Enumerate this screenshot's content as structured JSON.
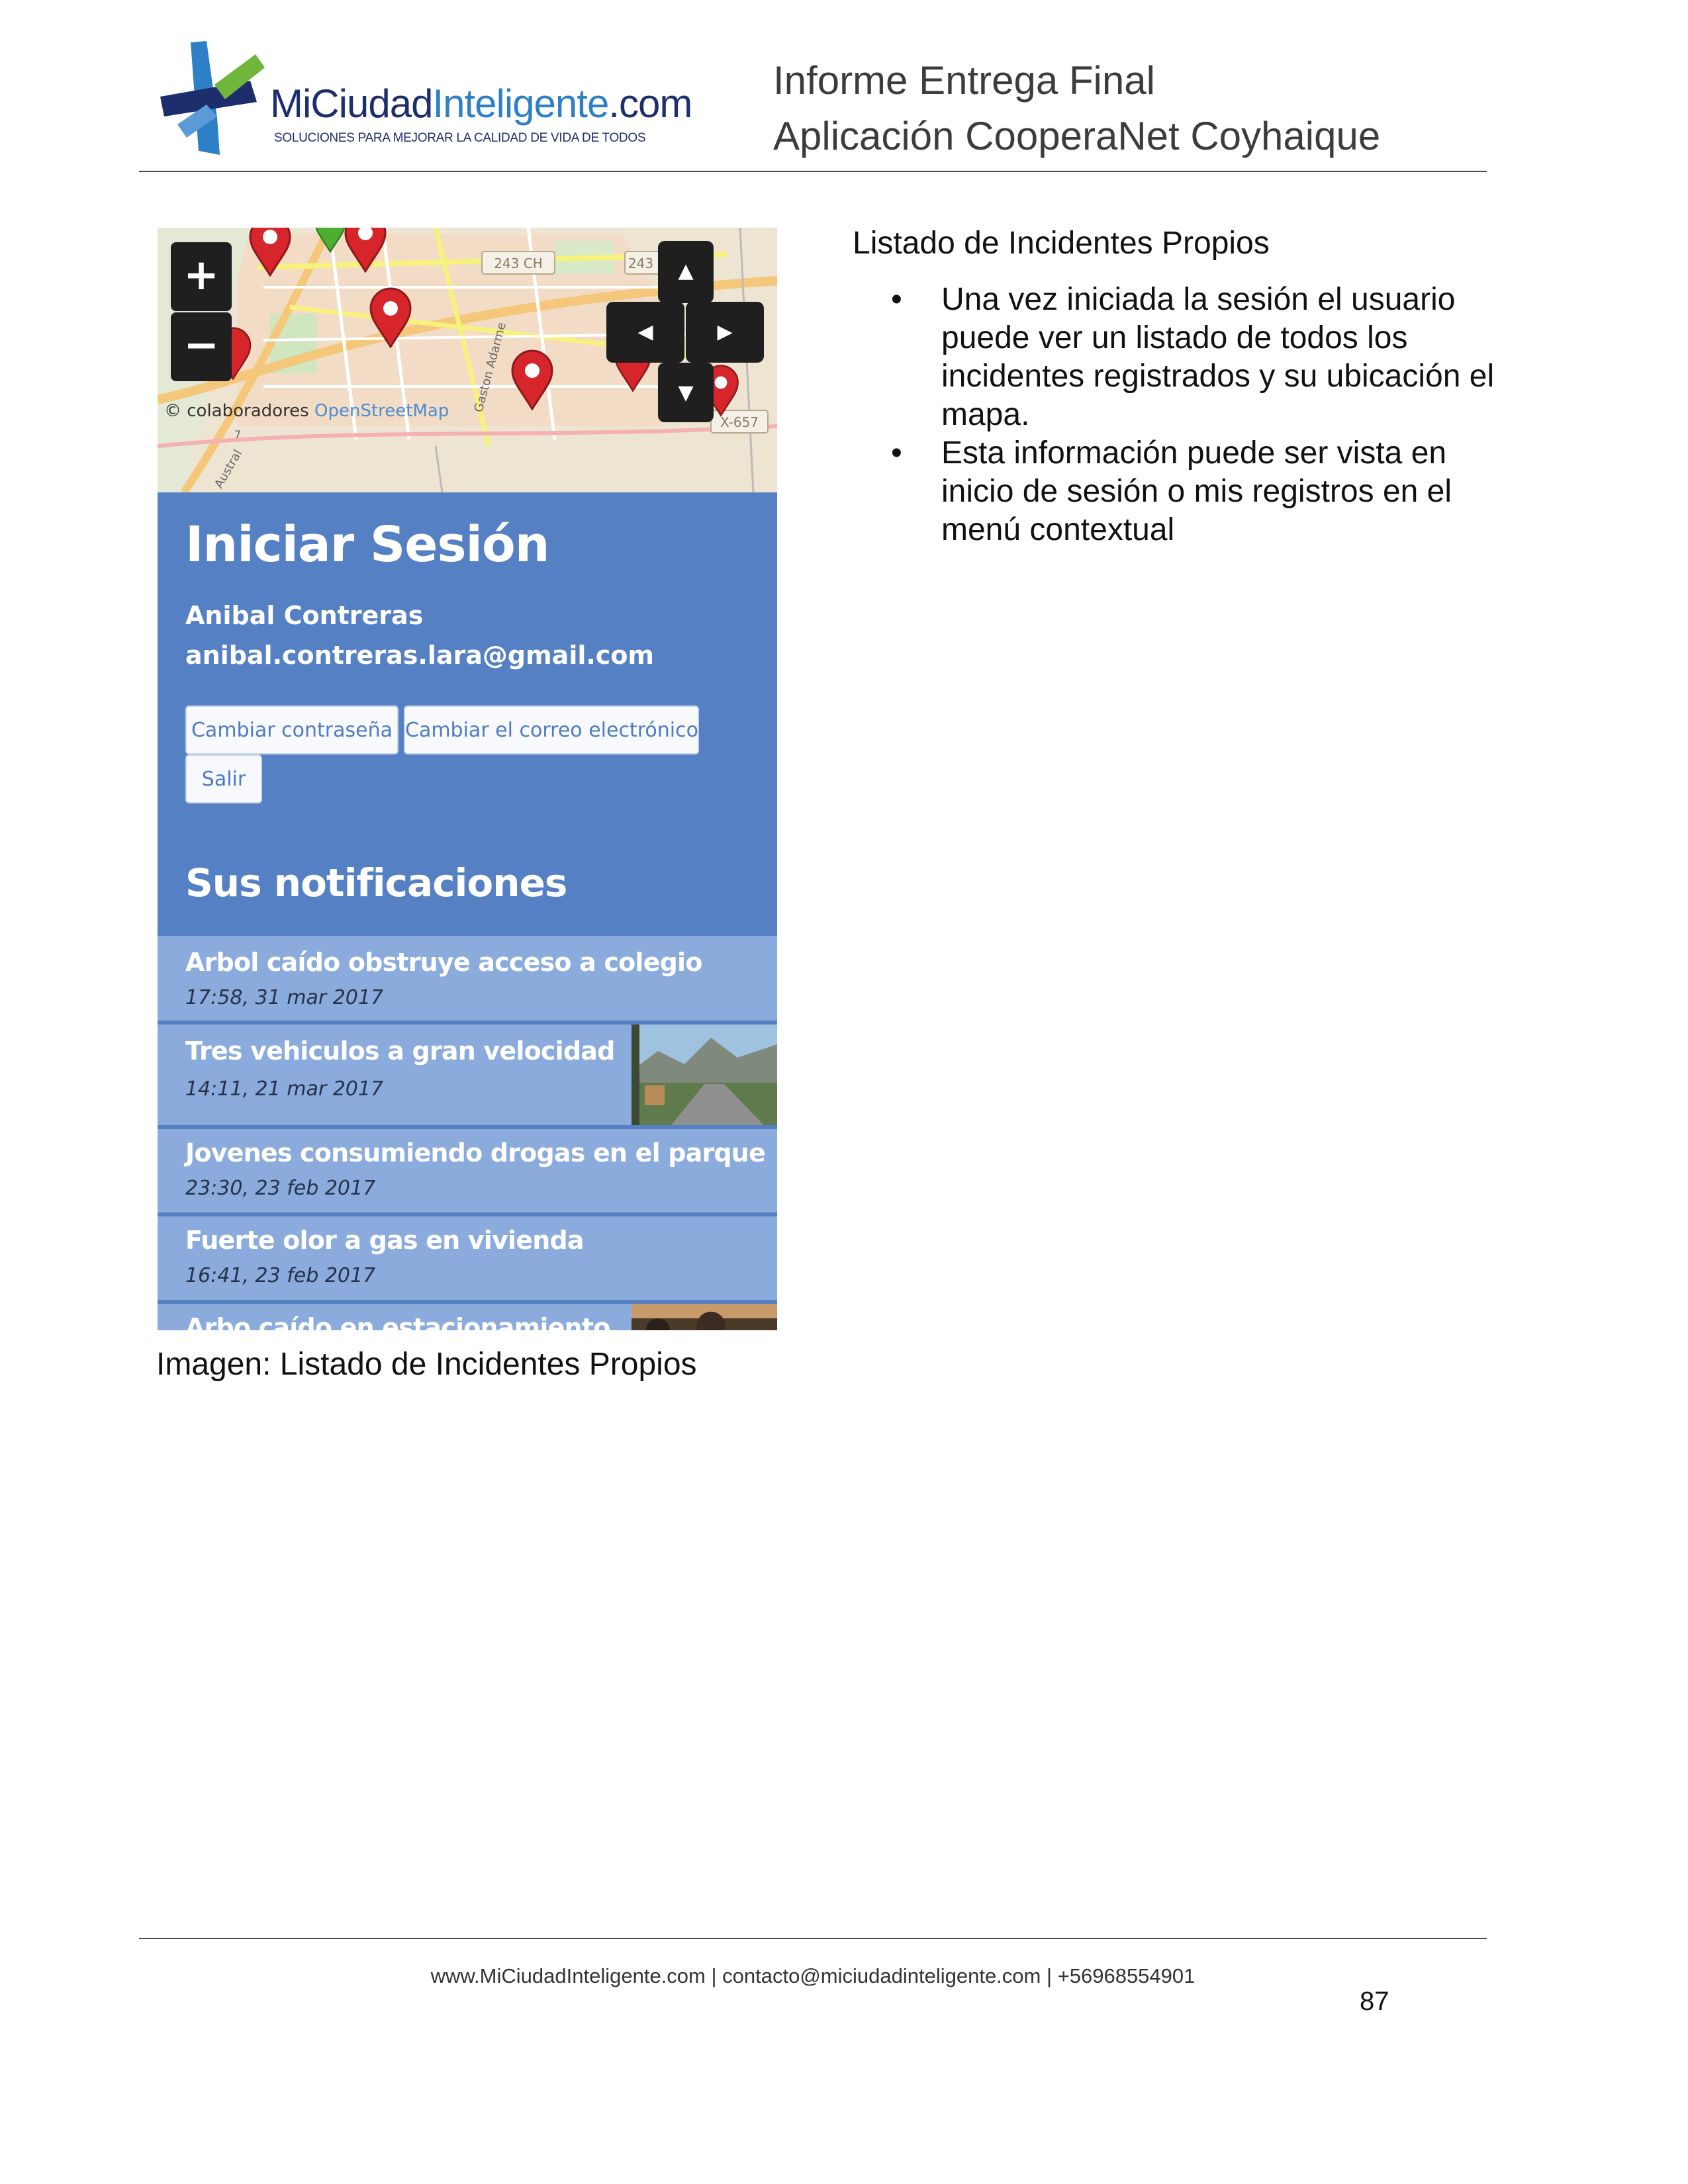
{
  "header": {
    "logo": {
      "wordmark_part1": "MiCiudad",
      "wordmark_part2": "Inteligente",
      "wordmark_part3": ".com",
      "tagline": "SOLUCIONES PARA MEJORAR LA CALIDAD DE VIDA DE TODOS"
    },
    "title_line1": "Informe Entrega Final",
    "title_line2": "Aplicación CooperaNet Coyhaique"
  },
  "screenshot": {
    "map": {
      "zoom_in": "+",
      "zoom_out": "−",
      "pan_up": "▲",
      "pan_left": "◀",
      "pan_right": "▶",
      "pan_down": "▼",
      "attribution_prefix": "© colaboradores",
      "attribution_link": "OpenStreetMap",
      "road_label_1": "243 CH",
      "road_label_2": "243",
      "road_label_3": "X-657",
      "street_label_1": "Gaston Adarme",
      "street_label_2": "Austral",
      "street_number": "7"
    },
    "login_title": "Iniciar Sesión",
    "user_name": "Anibal Contreras",
    "user_email": "anibal.contreras.lara@gmail.com",
    "buttons": {
      "change_password": "Cambiar contraseña",
      "change_email": "Cambiar el correo electrónico",
      "logout": "Salir"
    },
    "notifications_title": "Sus notificaciones",
    "notifications": [
      {
        "title": "Arbol caído obstruye acceso a colegio",
        "date": "17:58, 31 mar 2017"
      },
      {
        "title": "Tres vehiculos a gran velocidad",
        "date": "14:11, 21 mar 2017"
      },
      {
        "title": "Jovenes consumiendo drogas en el parque",
        "date": "23:30, 23 feb 2017"
      },
      {
        "title": "Fuerte olor a gas en vivienda",
        "date": "16:41, 23 feb 2017"
      },
      {
        "title": "Arbo caído en estacionamiento",
        "date": ""
      }
    ]
  },
  "section_title": "Listado de Incidentes Propios",
  "bullets": [
    "Una vez iniciada la sesión el usuario puede ver un listado de todos los incidentes registrados y su ubicación el mapa.",
    "Esta información puede ser vista en inicio de sesión o mis registros en el menú contextual"
  ],
  "caption": "Imagen: Listado de Incidentes Propios",
  "footer": {
    "text": "www.MiCiudadInteligente.com | contacto@miciudadinteligente.com | +56968554901",
    "page_number": "87"
  },
  "colors": {
    "panel_blue": "#5581c4",
    "notification_blue": "#8aabdb",
    "logo_navy": "#1d2e6c",
    "logo_blue": "#2d7fc6",
    "marker_red": "#d7262b"
  }
}
